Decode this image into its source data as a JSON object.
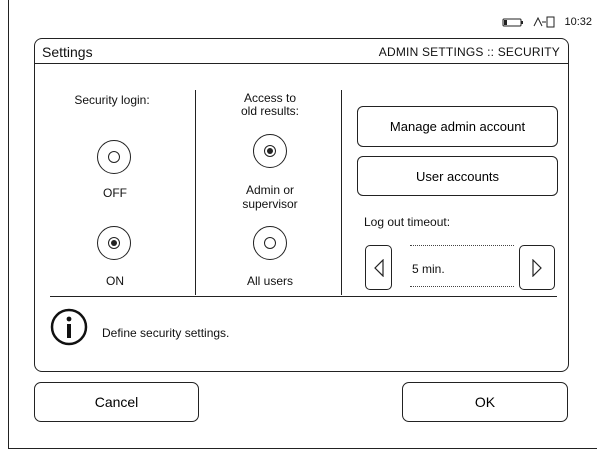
{
  "status_bar": {
    "battery_icon": "battery-icon",
    "network_icon": "network-icon",
    "time": "10:32"
  },
  "header": {
    "title": "Settings",
    "breadcrumb": "ADMIN SETTINGS :: SECURITY"
  },
  "security_login": {
    "label": "Security login:",
    "options": [
      {
        "label": "OFF",
        "selected": false
      },
      {
        "label": "ON",
        "selected": true
      }
    ]
  },
  "access_old_results": {
    "label_line1": "Access to",
    "label_line2": "old results:",
    "options": [
      {
        "label_line1": "Admin or",
        "label_line2": "supervisor",
        "selected": true
      },
      {
        "label_line1": "All users",
        "selected": false
      }
    ]
  },
  "actions": {
    "manage_admin": "Manage admin account",
    "user_accounts": "User accounts"
  },
  "logout_timeout": {
    "label": "Log out timeout:",
    "value": "5 min."
  },
  "info": {
    "icon": "info-icon",
    "message": "Define security settings."
  },
  "footer": {
    "cancel": "Cancel",
    "ok": "OK"
  }
}
